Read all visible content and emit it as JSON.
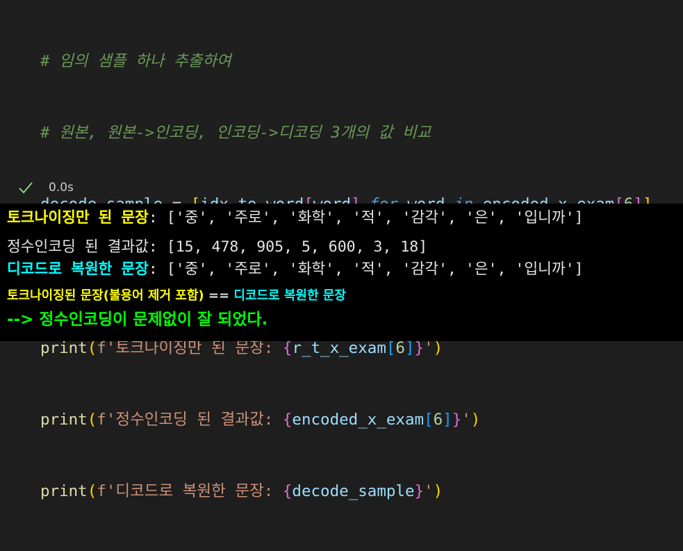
{
  "code": {
    "comment1": "# 임의 샘플 하나 추출하여",
    "comment2": "# 원본, 원본->인코딩, 인코딩->디코딩 3개의 값 비교",
    "line3": {
      "var": "decode_sample",
      "eq": " = ",
      "lbr": "[",
      "fn": "idx_to_word",
      "lbr2": "[",
      "word1": "word",
      "rbr2": "]",
      "for_kw": " for",
      "word2": " word",
      "in_kw": " in",
      "src": " encoded_x_exam",
      "lbr3": "[",
      "idx": "6",
      "rbr3": "]",
      "rbr": "]"
    },
    "print1": {
      "fn": "print",
      "lp": "(",
      "prefix": "f'토크나이징만 된 문장: ",
      "lb": "{",
      "expr": "r_t_x_exam",
      "lb2": "[",
      "idx": "6",
      "rb2": "]",
      "rb": "}",
      "suffix": "'",
      "rp": ")"
    },
    "print2": {
      "fn": "print",
      "lp": "(",
      "prefix": "f'정수인코딩 된 결과값: ",
      "lb": "{",
      "expr": "encoded_x_exam",
      "lb2": "[",
      "idx": "6",
      "rb2": "]",
      "rb": "}",
      "suffix": "'",
      "rp": ")"
    },
    "print3": {
      "fn": "print",
      "lp": "(",
      "prefix": "f'디코드로 복원한 문장: ",
      "lb": "{",
      "expr": "decode_sample",
      "rb": "}",
      "suffix": "'",
      "rp": ")"
    }
  },
  "status": {
    "time": "0.0s",
    "icon": "check-icon"
  },
  "output": {
    "line1_label": "토크나이징만 된 문장",
    "line1_rest": ": ['중', '주로', '화학', '적', '감각', '은', '입니까']",
    "line2": "정수인코딩 된 결과값: [15, 478, 905, 5, 600, 3, 18]",
    "line3_label": "디코드로 복원한 문장",
    "line3_rest": ": ['중', '주로', '화학', '적', '감각', '은', '입니까']",
    "line4_a": "토크나이징된 문장(불용어 제거 포함)",
    "line4_eq": " == ",
    "line4_b": "디코드로 복원한 문장",
    "line5": "--> 정수인코딩이 문제없이 잘 되었다."
  },
  "colors": {
    "comment": "#6a9955",
    "yellow": "#ffff00",
    "cyan": "#00ffff",
    "green": "#00ff00"
  }
}
